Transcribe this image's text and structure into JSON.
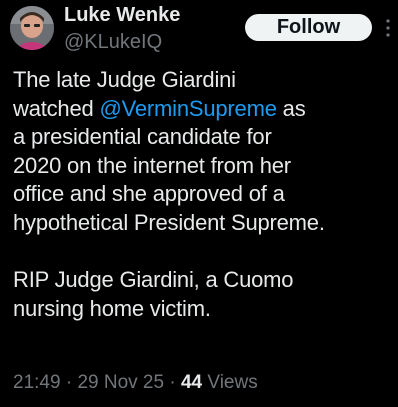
{
  "author": {
    "display_name": "Luke Wenke",
    "handle": "@KLukeIQ"
  },
  "follow_label": "Follow",
  "more_icon": "more-vertical-icon",
  "tweet": {
    "lines": [
      "The late Judge Giardini",
      {
        "before": "watched ",
        "mention": "@VerminSupreme",
        "after": " as"
      },
      "a presidential candidate for",
      "2020 on the internet from her",
      "office and she approved of a",
      "hypothetical President Supreme.",
      "",
      "RIP Judge Giardini, a Cuomo",
      "nursing home victim."
    ]
  },
  "meta": {
    "time": "21:49",
    "separator": "·",
    "date": "29 Nov 25",
    "views_count": "44",
    "views_label": "Views"
  },
  "colors": {
    "background": "#000000",
    "text": "#e7e9ea",
    "muted": "#71767b",
    "link": "#1d9bf0",
    "button_bg": "#eff3f4"
  }
}
